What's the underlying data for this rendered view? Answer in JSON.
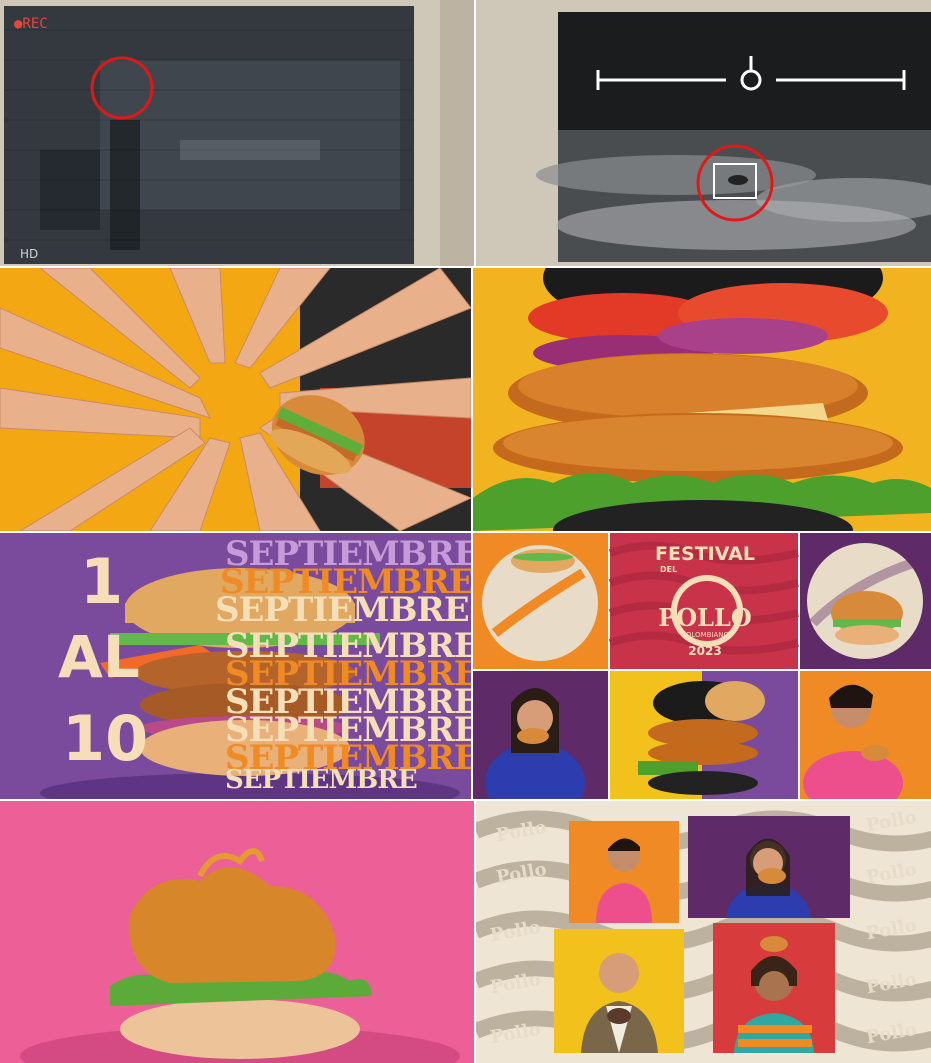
{
  "frames": [
    {
      "id": "cctv-frame",
      "overlay": {
        "rec": "●REC",
        "quality": "HD"
      }
    },
    {
      "id": "night-vision-frame"
    },
    {
      "id": "hands-burger-frame"
    },
    {
      "id": "black-bun-burger-frame"
    },
    {
      "id": "promo-date-frame",
      "promo": {
        "day_from": "1",
        "connector": "AL",
        "day_to": "10",
        "month": "SEPTIEMBRE"
      }
    },
    {
      "id": "festival-grid-frame",
      "logo": {
        "line1": "FESTIVAL",
        "line2": "DEL",
        "line3": "POLLO",
        "line4": "COLOMBIANO",
        "year": "2023"
      }
    },
    {
      "id": "crispy-chicken-frame"
    },
    {
      "id": "pollo-collage-frame",
      "pattern_word": "Pollo"
    }
  ],
  "colors": {
    "festival_red": "#c8334a",
    "purple": "#7a4a9c",
    "orange": "#f08a24",
    "yellow": "#f6b81c",
    "pink": "#ec5f97",
    "cream": "#f6dfb8"
  }
}
